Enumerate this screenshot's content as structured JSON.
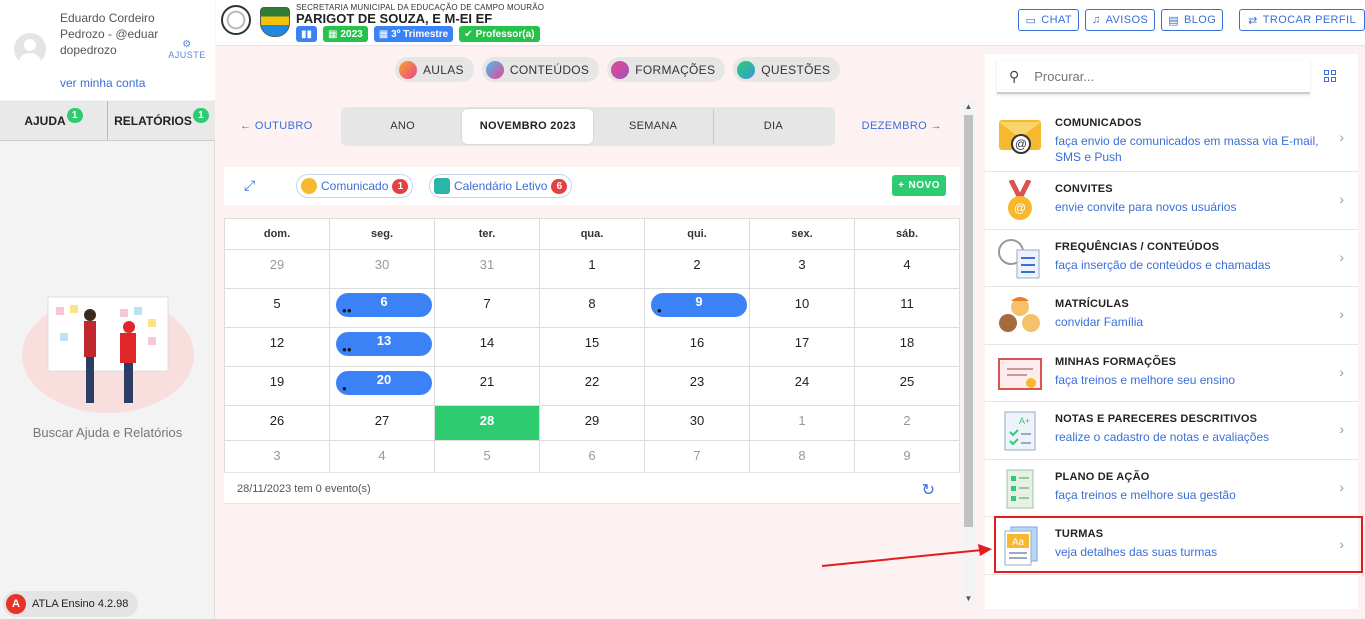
{
  "user": {
    "name_line": "Eduardo Cordeiro Pedrozo - @eduardopedrozo",
    "view_account": "ver minha conta",
    "settings": "AJUSTE"
  },
  "left_tabs": [
    {
      "label": "AJUDA",
      "badge": "1"
    },
    {
      "label": "RELATÓRIOS",
      "badge": "1"
    }
  ],
  "help_text": "Buscar Ajuda e Relatórios",
  "version": "ATLA Ensino 4.2.98",
  "header": {
    "secretaria": "SECRETARIA MUNICIPAL DA EDUCAÇÃO DE CAMPO MOURÃO",
    "school": "PARIGOT DE SOUZA, E M-EI EF",
    "badges": {
      "year": "2023",
      "term": "3º Trimestre",
      "role": "Professor(a)"
    },
    "buttons": {
      "chat": "CHAT",
      "avisos": "AVISOS",
      "blog": "BLOG",
      "trocar": "TROCAR PERFIL"
    }
  },
  "pills": [
    "AULAS",
    "CONTEÚDOS",
    "FORMAÇÕES",
    "QUESTÕES"
  ],
  "calendar": {
    "prev": "OUTUBRO",
    "next": "DEZEMBRO",
    "views": [
      "ANO",
      "NOVEMBRO 2023",
      "SEMANA",
      "DIA"
    ],
    "chips": [
      {
        "label": "Comunicado",
        "badge": "1"
      },
      {
        "label": "Calendário Letivo",
        "badge": "6"
      }
    ],
    "new_button": "NOVO",
    "weekdays": [
      "dom.",
      "seg.",
      "ter.",
      "qua.",
      "qui.",
      "sex.",
      "sáb."
    ],
    "weeks": [
      [
        "29",
        "30",
        "31",
        "1",
        "2",
        "3",
        "4"
      ],
      [
        "5",
        "6",
        "7",
        "8",
        "9",
        "10",
        "11"
      ],
      [
        "12",
        "13",
        "14",
        "15",
        "16",
        "17",
        "18"
      ],
      [
        "19",
        "20",
        "21",
        "22",
        "23",
        "24",
        "25"
      ],
      [
        "26",
        "27",
        "28",
        "29",
        "30",
        "1",
        "2"
      ],
      [
        "3",
        "4",
        "5",
        "6",
        "7",
        "8",
        "9"
      ]
    ],
    "footer": "28/11/2023 tem 0 evento(s)"
  },
  "right": {
    "search_placeholder": "Procurar...",
    "items": [
      {
        "title": "COMUNICADOS",
        "desc": "faça envio de comunicados em massa via E-mail, SMS e Push"
      },
      {
        "title": "CONVITES",
        "desc": "envie convite para novos usuários"
      },
      {
        "title": "FREQUÊNCIAS / CONTEÚDOS",
        "desc": "faça inserção de conteúdos e chamadas"
      },
      {
        "title": "MATRÍCULAS",
        "desc": "convidar Família"
      },
      {
        "title": "MINHAS FORMAÇÕES",
        "desc": "faça treinos e melhore seu ensino"
      },
      {
        "title": "NOTAS E PARECERES DESCRITIVOS",
        "desc": "realize o cadastro de notas e avaliações"
      },
      {
        "title": "PLANO DE AÇÃO",
        "desc": "faça treinos e melhore sua gestão"
      },
      {
        "title": "TURMAS",
        "desc": "veja detalhes das suas turmas"
      }
    ]
  },
  "colors": {
    "accent": "#3a6fd8",
    "green": "#2ecc71",
    "event_blue": "#3b82f6",
    "highlight_red": "#e11d1d"
  }
}
